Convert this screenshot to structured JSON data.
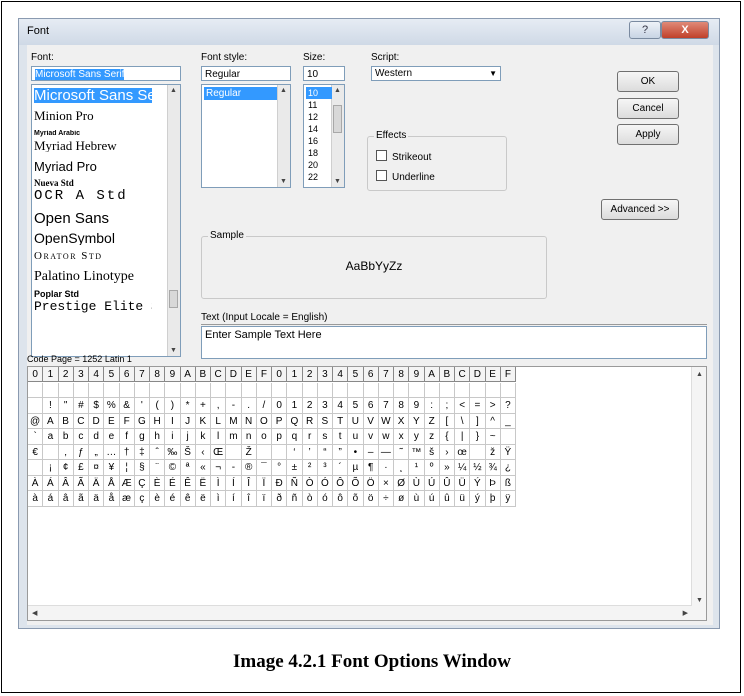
{
  "window": {
    "title": "Font",
    "help_glyph": "?",
    "close_glyph": "X"
  },
  "font": {
    "label": "Font:",
    "value": "Microsoft Sans Serif",
    "items": [
      "Microsoft Sans Serif",
      "Minion Pro",
      "Myriad Arabic",
      "Myriad Hebrew",
      "Myriad Pro",
      "Nueva Std",
      "OCR A Std",
      "Open Sans",
      "OpenSymbol",
      "Orator Std",
      "Palatino Linotype",
      "Poplar Std",
      "Prestige Elite Std"
    ]
  },
  "style": {
    "label": "Font style:",
    "value": "Regular",
    "items": [
      "Regular"
    ]
  },
  "size": {
    "label": "Size:",
    "value": "10",
    "items": [
      "10",
      "11",
      "12",
      "14",
      "16",
      "18",
      "20",
      "22"
    ]
  },
  "script": {
    "label": "Script:",
    "value": "Western"
  },
  "buttons": {
    "ok": "OK",
    "cancel": "Cancel",
    "apply": "Apply",
    "advanced": "Advanced >>"
  },
  "effects": {
    "label": "Effects",
    "strikeout": "Strikeout",
    "underline": "Underline"
  },
  "sample": {
    "label": "Sample",
    "text": "AaBbYyZz"
  },
  "text_input": {
    "label": "Text (Input Locale = English)",
    "value": "Enter Sample Text Here"
  },
  "code_page": "Code Page = 1252 Latin 1",
  "chargrid": {
    "header": [
      "0",
      "1",
      "2",
      "3",
      "4",
      "5",
      "6",
      "7",
      "8",
      "9",
      "A",
      "B",
      "C",
      "D",
      "E",
      "F",
      "0",
      "1",
      "2",
      "3",
      "4",
      "5",
      "6",
      "7",
      "8",
      "9",
      "A",
      "B",
      "C",
      "D",
      "E",
      "F"
    ],
    "rows": [
      [
        " ",
        " ",
        " ",
        " ",
        " ",
        " ",
        " ",
        " ",
        " ",
        " ",
        " ",
        " ",
        " ",
        " ",
        " ",
        " ",
        " ",
        " ",
        " ",
        " ",
        " ",
        " ",
        " ",
        " ",
        " ",
        " ",
        " ",
        " ",
        " ",
        " ",
        " ",
        " "
      ],
      [
        " ",
        "!",
        "\"",
        "#",
        "$",
        "%",
        "&",
        "'",
        "(",
        ")",
        "*",
        "+",
        ",",
        "-",
        ".",
        "/",
        "0",
        "1",
        "2",
        "3",
        "4",
        "5",
        "6",
        "7",
        "8",
        "9",
        ":",
        ";",
        "<",
        "=",
        ">",
        "?"
      ],
      [
        "@",
        "A",
        "B",
        "C",
        "D",
        "E",
        "F",
        "G",
        "H",
        "I",
        "J",
        "K",
        "L",
        "M",
        "N",
        "O",
        "P",
        "Q",
        "R",
        "S",
        "T",
        "U",
        "V",
        "W",
        "X",
        "Y",
        "Z",
        "[",
        "\\",
        "]",
        "^",
        "_"
      ],
      [
        "`",
        "a",
        "b",
        "c",
        "d",
        "e",
        "f",
        "g",
        "h",
        "i",
        "j",
        "k",
        "l",
        "m",
        "n",
        "o",
        "p",
        "q",
        "r",
        "s",
        "t",
        "u",
        "v",
        "w",
        "x",
        "y",
        "z",
        "{",
        "|",
        "}",
        "~",
        " "
      ],
      [
        "€",
        " ",
        "‚",
        "ƒ",
        "„",
        "…",
        "†",
        "‡",
        "ˆ",
        "‰",
        "Š",
        "‹",
        "Œ",
        " ",
        "Ž",
        " ",
        " ",
        "‘",
        "’",
        "“",
        "”",
        "•",
        "–",
        "—",
        "˜",
        "™",
        "š",
        "›",
        "œ",
        " ",
        "ž",
        "Ÿ"
      ],
      [
        " ",
        "¡",
        "¢",
        "£",
        "¤",
        "¥",
        "¦",
        "§",
        "¨",
        "©",
        "ª",
        "«",
        "¬",
        "-",
        "®",
        "¯",
        "°",
        "±",
        "²",
        "³",
        "´",
        "µ",
        "¶",
        "·",
        "¸",
        "¹",
        "º",
        "»",
        "¼",
        "½",
        "¾",
        "¿"
      ],
      [
        "À",
        "Á",
        "Â",
        "Ã",
        "Ä",
        "Å",
        "Æ",
        "Ç",
        "È",
        "É",
        "Ê",
        "Ë",
        "Ì",
        "Í",
        "Î",
        "Ï",
        "Ð",
        "Ñ",
        "Ò",
        "Ó",
        "Ô",
        "Õ",
        "Ö",
        "×",
        "Ø",
        "Ù",
        "Ú",
        "Û",
        "Ü",
        "Ý",
        "Þ",
        "ß"
      ],
      [
        "à",
        "á",
        "â",
        "ã",
        "ä",
        "å",
        "æ",
        "ç",
        "è",
        "é",
        "ê",
        "ë",
        "ì",
        "í",
        "î",
        "ï",
        "ð",
        "ñ",
        "ò",
        "ó",
        "ô",
        "õ",
        "ö",
        "÷",
        "ø",
        "ù",
        "ú",
        "û",
        "ü",
        "ý",
        "þ",
        "ÿ"
      ]
    ]
  },
  "caption": "Image 4.2.1 Font Options Window"
}
